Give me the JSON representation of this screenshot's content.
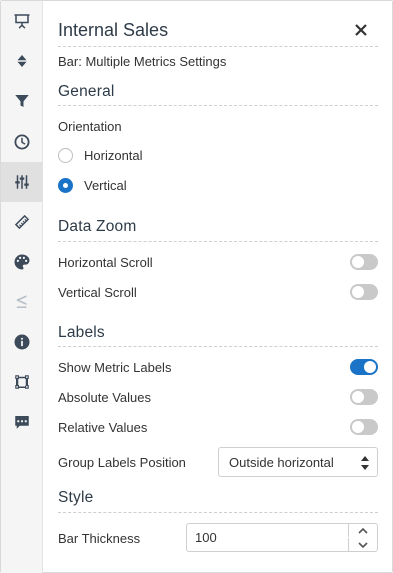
{
  "rail": {
    "items": [
      {
        "icon": "presentation-icon",
        "active": false,
        "disabled": false
      },
      {
        "icon": "sort-icon",
        "active": false,
        "disabled": false
      },
      {
        "icon": "filter-icon",
        "active": false,
        "disabled": false
      },
      {
        "icon": "clock-icon",
        "active": false,
        "disabled": false
      },
      {
        "icon": "sliders-icon",
        "active": true,
        "disabled": false
      },
      {
        "icon": "ruler-icon",
        "active": false,
        "disabled": false
      },
      {
        "icon": "palette-icon",
        "active": false,
        "disabled": false
      },
      {
        "icon": "less-equal-icon",
        "active": false,
        "disabled": true
      },
      {
        "icon": "info-icon",
        "active": false,
        "disabled": false
      },
      {
        "icon": "selection-icon",
        "active": false,
        "disabled": false
      },
      {
        "icon": "comment-icon",
        "active": false,
        "disabled": false
      }
    ]
  },
  "panel": {
    "title": "Internal Sales",
    "close_icon": "close-icon",
    "subtitle": "Bar: Multiple Metrics Settings"
  },
  "general": {
    "heading": "General",
    "orientation_label": "Orientation",
    "options": [
      {
        "label": "Horizontal",
        "checked": false
      },
      {
        "label": "Vertical",
        "checked": true
      }
    ]
  },
  "data_zoom": {
    "heading": "Data Zoom",
    "horizontal_scroll": {
      "label": "Horizontal Scroll",
      "on": false
    },
    "vertical_scroll": {
      "label": "Vertical Scroll",
      "on": false
    }
  },
  "labels": {
    "heading": "Labels",
    "show_metric_labels": {
      "label": "Show Metric Labels",
      "on": true
    },
    "absolute_values": {
      "label": "Absolute Values",
      "on": false
    },
    "relative_values": {
      "label": "Relative Values",
      "on": false
    },
    "group_labels_position": {
      "label": "Group Labels Position",
      "value": "Outside horizontal"
    }
  },
  "style": {
    "heading": "Style",
    "bar_thickness": {
      "label": "Bar Thickness",
      "value": "100"
    }
  },
  "colors": {
    "accent": "#1a73c7",
    "toggle_off": "#c9c9c9",
    "rail_bg": "#f5f5f5",
    "rail_active": "#e0e0e0",
    "icon": "#3c4a5a"
  }
}
